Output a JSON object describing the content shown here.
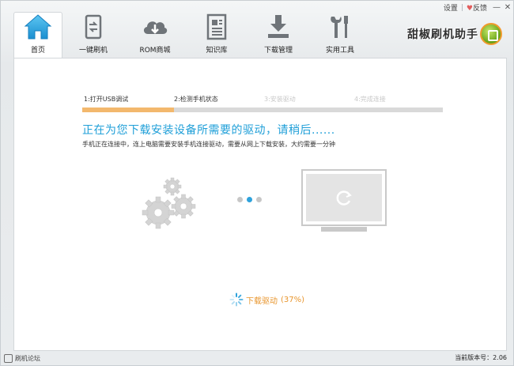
{
  "system": {
    "settings_label": "设置",
    "feedback_label": "反馈",
    "minimize_symbol": "—",
    "close_symbol": "✕"
  },
  "nav": {
    "items": [
      {
        "label": "首页",
        "icon": "home-icon",
        "active": true
      },
      {
        "label": "一键刷机",
        "icon": "phone-flash-icon"
      },
      {
        "label": "ROM商城",
        "icon": "cloud-download-icon"
      },
      {
        "label": "知识库",
        "icon": "document-icon"
      },
      {
        "label": "下载管理",
        "icon": "download-tray-icon"
      },
      {
        "label": "实用工具",
        "icon": "tools-icon"
      }
    ]
  },
  "brand": {
    "name": "甜椒刷机助手"
  },
  "steps": [
    {
      "label": "1:打开USB调试",
      "state": "done"
    },
    {
      "label": "2:检测手机状态",
      "state": "current"
    },
    {
      "label": "3:安装驱动",
      "state": "pending"
    },
    {
      "label": "4:完成连接",
      "state": "pending"
    }
  ],
  "main": {
    "headline": "正在为您下载安装设备所需要的驱动，请稍后......",
    "subline": "手机正在连接中，连上电脑需要安装手机连接驱动，需要从网上下载安装，大约需要一分钟",
    "progress_label": "下载驱动",
    "progress_percent": "(37%)",
    "progress_value": 37
  },
  "status": {
    "left_text": "刷机论坛",
    "version": "当前版本号：2.06"
  },
  "colors": {
    "accent_blue": "#1f9fd8",
    "step_done": "#f3b86d",
    "progress_orange": "#e8962e"
  }
}
